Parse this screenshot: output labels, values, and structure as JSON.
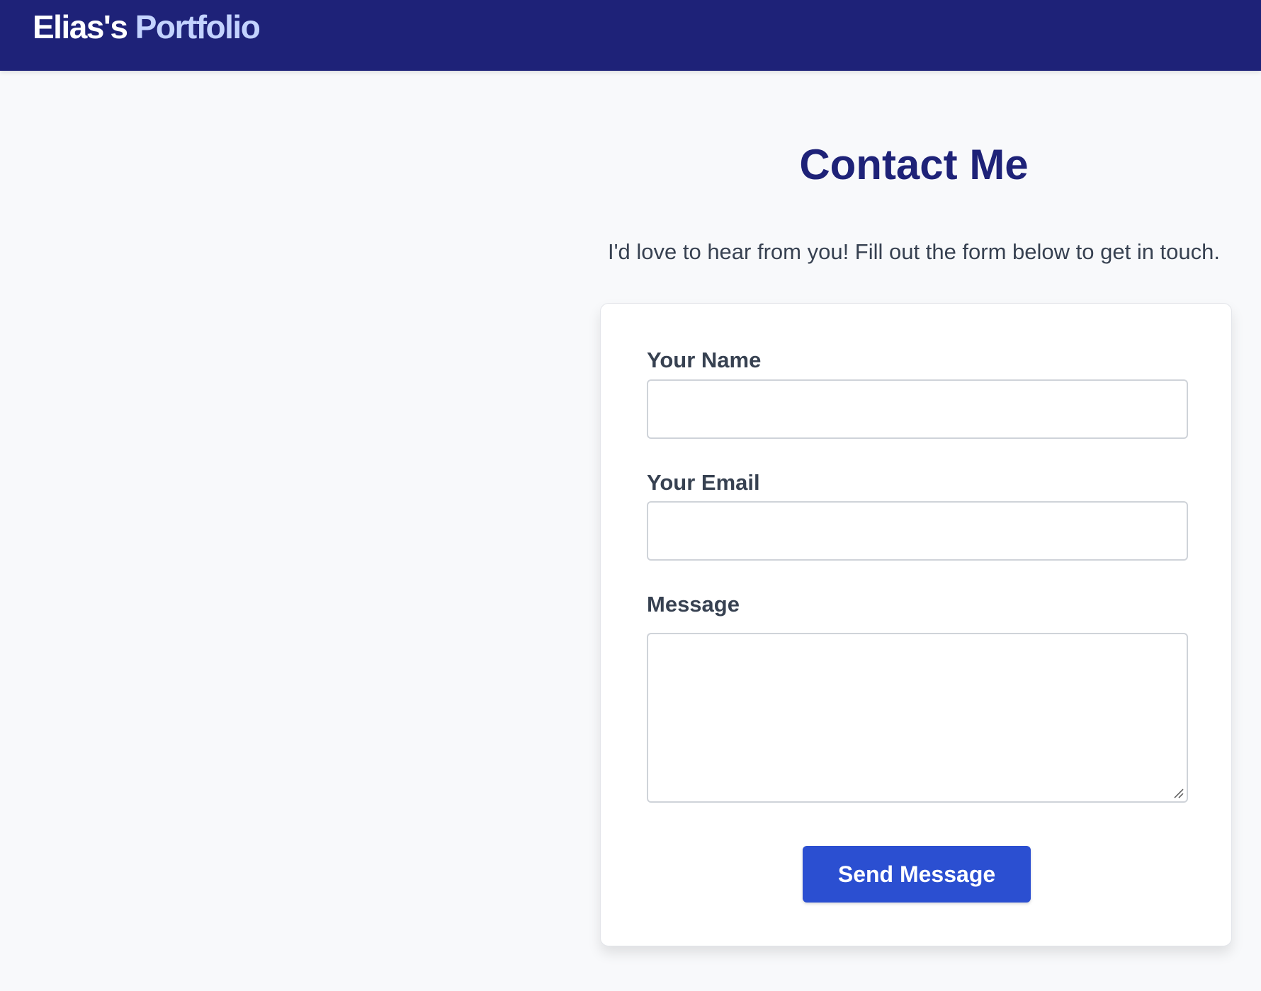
{
  "header": {
    "brand_first": "Elias's",
    "brand_second": "Portfolio"
  },
  "contact": {
    "title": "Contact Me",
    "intro": "I'd love to hear from you! Fill out the form below to get in touch.",
    "name_label": "Your Name",
    "name_value": "",
    "email_label": "Your Email",
    "email_value": "",
    "message_label": "Message",
    "message_value": "",
    "send_label": "Send Message"
  },
  "colors": {
    "header_bg": "#1e2278",
    "brand_accent": "#c3d3ff",
    "title": "#1e2278",
    "button_bg": "#2b4fd1",
    "page_bg": "#f8f9fb"
  },
  "icons": {
    "textarea_resize": "resize-handle-icon"
  }
}
